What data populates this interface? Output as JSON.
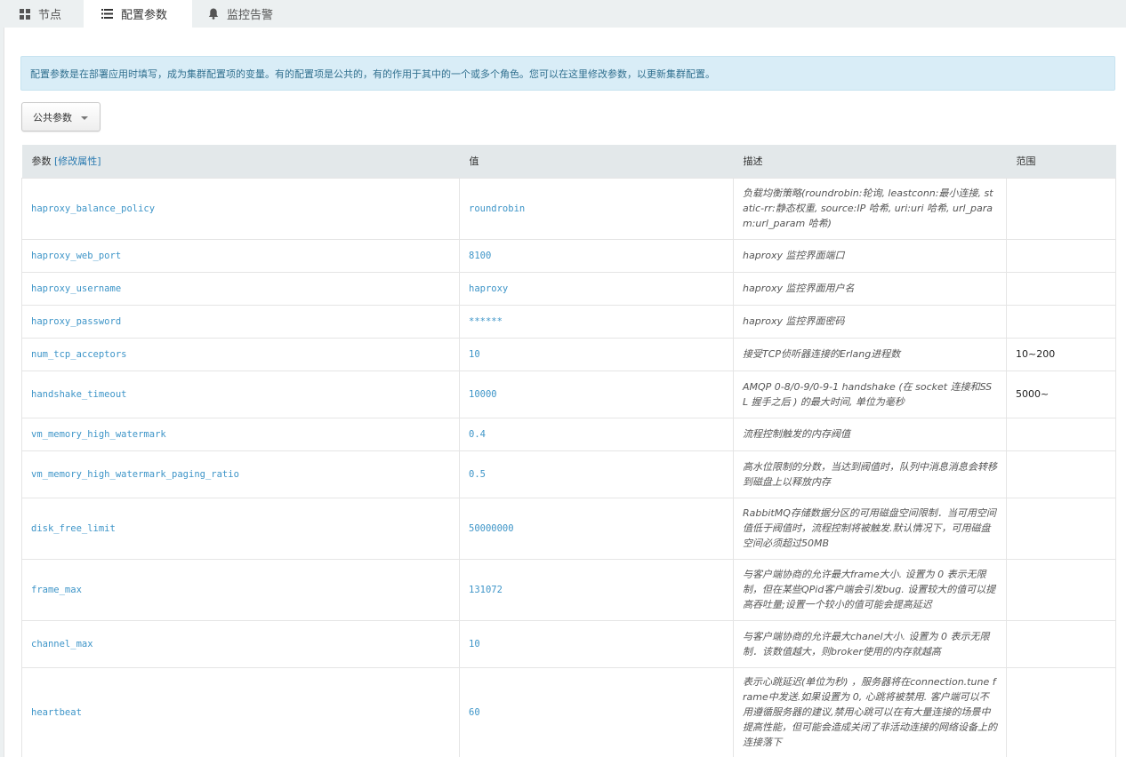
{
  "tabs": [
    {
      "label": "节点",
      "icon": "grid-icon"
    },
    {
      "label": "配置参数",
      "icon": "list-icon"
    },
    {
      "label": "监控告警",
      "icon": "bell-icon"
    }
  ],
  "alert_text": "配置参数是在部署应用时填写，成为集群配置项的变量。有的配置项是公共的，有的作用于其中的一个或多个角色。您可以在这里修改参数，以更新集群配置。",
  "dropdown": {
    "selected": "公共参数"
  },
  "table": {
    "headers": {
      "param": "参数",
      "edit_link": "[修改属性]",
      "value": "值",
      "desc": "描述",
      "range": "范围"
    },
    "rows": [
      {
        "param": "haproxy_balance_policy",
        "value": "roundrobin",
        "desc": "负载均衡策略(roundrobin:轮询, leastconn:最小连接, static-rr:静态权重, source:IP 哈希, uri:uri 哈希, url_param:url_param 哈希)",
        "range": ""
      },
      {
        "param": "haproxy_web_port",
        "value": "8100",
        "desc": "haproxy 监控界面端口",
        "range": ""
      },
      {
        "param": "haproxy_username",
        "value": "haproxy",
        "desc": "haproxy 监控界面用户名",
        "range": ""
      },
      {
        "param": "haproxy_password",
        "value": "******",
        "desc": "haproxy 监控界面密码",
        "range": ""
      },
      {
        "param": "num_tcp_acceptors",
        "value": "10",
        "desc": "接受TCP侦听器连接的Erlang进程数",
        "range": "10~200"
      },
      {
        "param": "handshake_timeout",
        "value": "10000",
        "desc": "AMQP 0-8/0-9/0-9-1 handshake (在 socket 连接和SSL 握手之后 ) 的最大时间, 单位为毫秒",
        "range": "5000~"
      },
      {
        "param": "vm_memory_high_watermark",
        "value": "0.4",
        "desc": "流程控制触发的内存阀值",
        "range": ""
      },
      {
        "param": "vm_memory_high_watermark_paging_ratio",
        "value": "0.5",
        "desc": "高水位限制的分数，当达到阀值时，队列中消息消息会转移到磁盘上以释放内存",
        "range": ""
      },
      {
        "param": "disk_free_limit",
        "value": "50000000",
        "desc": "RabbitMQ存储数据分区的可用磁盘空间限制．当可用空间值低于阀值时，流程控制将被触发.默认情况下，可用磁盘空间必须超过50MB",
        "range": ""
      },
      {
        "param": "frame_max",
        "value": "131072",
        "desc": "与客户端协商的允许最大frame大小. 设置为 0 表示无限制，但在某些QPid客户端会引发bug. 设置较大的值可以提高吞吐量;设置一个较小的值可能会提高延迟",
        "range": ""
      },
      {
        "param": "channel_max",
        "value": "10",
        "desc": "与客户端协商的允许最大chanel大小. 设置为 0 表示无限制．该数值越大，则broker使用的内存就越高",
        "range": ""
      },
      {
        "param": "heartbeat",
        "value": "60",
        "desc": "表示心跳延迟(单位为秒) ，服务器将在connection.tune frame中发送.如果设置为 0, 心跳将被禁用. 客户端可以不用遵循服务器的建议,禁用心跳可以在有大量连接的场景中提高性能，但可能会造成关闭了非活动连接的网络设备上的连接落下",
        "range": ""
      }
    ]
  }
}
